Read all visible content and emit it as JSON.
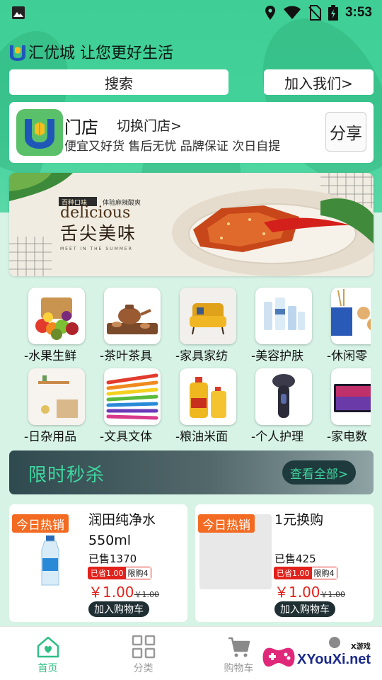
{
  "app": {
    "title": "汇优城 让您更好生活"
  },
  "status_bar": {
    "time": "3:53"
  },
  "top_buttons": {
    "search": "搜索",
    "join": "加入我们>"
  },
  "store": {
    "name": "门店",
    "switch": "切换门店>",
    "slogan": "便宜又好货 售后无忧 品牌保证 次日自提",
    "share": "分享"
  },
  "banner": {
    "tag_left": "百种口味",
    "tag_right": "体验麻辣酸爽",
    "headline_en": "delicious",
    "headline_cn": "舌尖美味",
    "footer_en": "MEET IN THE SUMMER"
  },
  "categories": [
    {
      "label": "-水果生鲜",
      "icon": "fruit-icon"
    },
    {
      "label": "-茶叶茶具",
      "icon": "tea-icon"
    },
    {
      "label": "-家具家纺",
      "icon": "sofa-icon"
    },
    {
      "label": "-美容护肤",
      "icon": "skincare-icon"
    },
    {
      "label": "-休闲零",
      "icon": "snack-icon"
    },
    {
      "label": "-日杂用品",
      "icon": "shelf-icon"
    },
    {
      "label": "-文具文体",
      "icon": "pencils-icon"
    },
    {
      "label": "-粮油米面",
      "icon": "oil-icon"
    },
    {
      "label": "-个人护理",
      "icon": "shaver-icon"
    },
    {
      "label": "-家电数",
      "icon": "tv-icon"
    }
  ],
  "flash_sale": {
    "title": "限时秒杀",
    "more": "查看全部>"
  },
  "products": [
    {
      "hot": "今日热销",
      "name": "润田纯净水550ml",
      "sold": "已售1370",
      "save": "已省1.00",
      "limit": "限购4",
      "price": "￥1.00",
      "old_price": "￥1.00",
      "cart": "加入购物车"
    },
    {
      "hot": "今日热销",
      "name": "1元换购",
      "sold": "已售425",
      "save": "已省1.00",
      "limit": "限购4",
      "price": "￥1.00",
      "old_price": "￥1.00",
      "cart": "加入购物车"
    }
  ],
  "nav": [
    {
      "label": "首页",
      "icon": "home-icon"
    },
    {
      "label": "分类",
      "icon": "category-icon"
    },
    {
      "label": "购物车",
      "icon": "cart-icon"
    },
    {
      "label": "",
      "icon": "profile-icon"
    }
  ],
  "watermark": {
    "text": "XYouXi.net",
    "sub": "X游戏"
  },
  "colors": {
    "accent": "#2fbf86",
    "price": "#e2221c",
    "hot_tag": "#f36b22"
  }
}
